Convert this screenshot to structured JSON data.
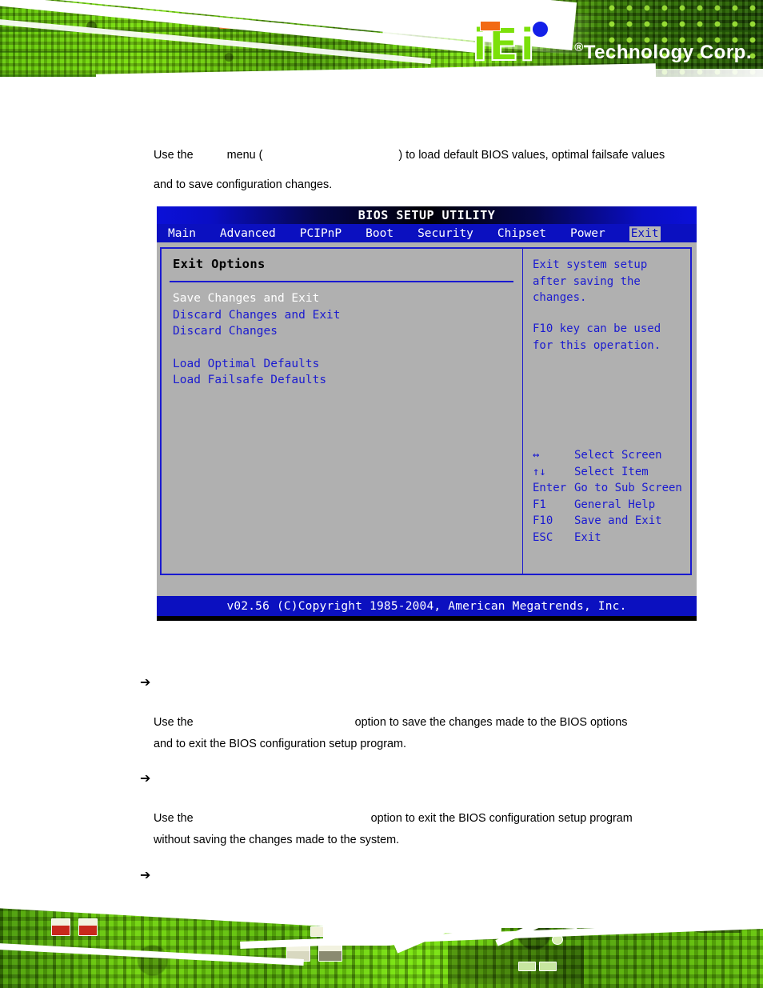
{
  "header": {
    "logo_letters": "iEi",
    "logo_text": "Technology Corp",
    "logo_registered": "®",
    "logo_period": "."
  },
  "document": {
    "intro_part1": "Use the",
    "intro_part2": "menu (",
    "intro_part3": ") to load default BIOS values, optimal failsafe values",
    "intro_line2": "and to save configuration changes.",
    "bullet_arrow": "➔",
    "section1": {
      "heading": "",
      "line1_pre": "Use the",
      "line1_post": "option to save the changes made to the BIOS options",
      "line2": "and to exit the BIOS configuration setup program."
    },
    "section2": {
      "heading": "",
      "line1_pre": "Use the",
      "line1_post": "option to exit the BIOS configuration setup program",
      "line2": "without saving the changes made to the system."
    },
    "section3": {
      "heading": ""
    }
  },
  "bios": {
    "title": "BIOS SETUP UTILITY",
    "menu_tabs": [
      {
        "label": "Main",
        "active": false
      },
      {
        "label": "Advanced",
        "active": false
      },
      {
        "label": "PCIPnP",
        "active": false
      },
      {
        "label": "Boot",
        "active": false
      },
      {
        "label": "Security",
        "active": false
      },
      {
        "label": "Chipset",
        "active": false
      },
      {
        "label": "Power",
        "active": false
      },
      {
        "label": "Exit",
        "active": true
      }
    ],
    "section_title": "Exit Options",
    "options": [
      {
        "label": "Save Changes and Exit",
        "selected": true
      },
      {
        "label": "Discard Changes and Exit",
        "selected": false
      },
      {
        "label": "Discard Changes",
        "selected": false
      },
      {
        "label": "",
        "selected": false
      },
      {
        "label": "Load Optimal Defaults",
        "selected": false
      },
      {
        "label": "Load Failsafe Defaults",
        "selected": false
      }
    ],
    "help_text": "Exit system setup\nafter saving the\nchanges.",
    "help_text2": "F10 key can be used\nfor this operation.",
    "legend": [
      {
        "key": "↔",
        "value": "Select Screen"
      },
      {
        "key": "↑↓",
        "value": "Select Item"
      },
      {
        "key": "Enter",
        "value": "Go to Sub Screen"
      },
      {
        "key": "F1",
        "value": "General Help"
      },
      {
        "key": "F10",
        "value": "Save and Exit"
      },
      {
        "key": "ESC",
        "value": "Exit"
      }
    ],
    "footer": "v02.56 (C)Copyright 1985-2004, American Megatrends, Inc.",
    "colors": {
      "panel_bg": "#b0b0b0",
      "blue": "#1a1ad0",
      "menubar_blue": "#0b10c0",
      "selected_text": "#ffffff",
      "title_text": "#000000"
    }
  }
}
